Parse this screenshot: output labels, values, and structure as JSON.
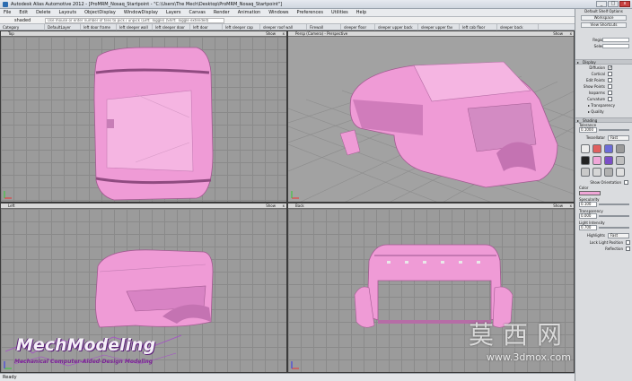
{
  "window": {
    "title": "Autodesk Alias Automotive 2012 - [ProMRM_Nosaq_Startpoint - \"C:\\Users\\The Mech\\Desktop\\ProMRM_Nosaq_Startpoint\"]",
    "minimize": "_",
    "maximize": "□",
    "close": "x"
  },
  "menu": [
    "File",
    "Edit",
    "Delete",
    "Layouts",
    "ObjectDisplay",
    "WindowDisplay",
    "Layers",
    "Canvas",
    "Render",
    "Animation",
    "Windows",
    "Preferences",
    "Utilities",
    "Help"
  ],
  "command": {
    "name": "shaded",
    "placeholder": "Use mouse or enter number of tiles to pick / unpick (Left: Toggle) (Shift: Toggle extended)"
  },
  "shelf": [
    "Category",
    "DefaultLayer",
    "left door frame",
    "left sleeper wall",
    "left sleeper door",
    "left door",
    "left sleeper cap",
    "sleeper roof wall",
    "Firewall",
    "sleeper floor",
    "sleeper upper back",
    "sleeper upper fav",
    "left cab floor",
    "sleeper back"
  ],
  "viewports": [
    {
      "label": "Top",
      "controls": "Show",
      "close": "x"
    },
    {
      "label": "Persp (Camera) - Perspective",
      "controls": "Show",
      "close": "x"
    },
    {
      "label": "Left",
      "controls": "Show",
      "close": "x"
    },
    {
      "label": "Back",
      "controls": "Show",
      "close": "x"
    }
  ],
  "status": "Ready",
  "panel": {
    "title": "Default Shelf Options",
    "buttons": [
      "Workspace",
      "View Shortcuts"
    ],
    "rows_top": [
      "Region",
      "Select"
    ],
    "display_section": "Display",
    "display_rows": [
      {
        "label": "Diffusion",
        "checked": "✓"
      },
      {
        "label": "Cortical",
        "checked": ""
      },
      {
        "label": "Edit Points",
        "checked": ""
      },
      {
        "label": "Show Points",
        "checked": ""
      },
      {
        "label": "Isoparms",
        "checked": ""
      },
      {
        "label": "Curvature",
        "checked": ""
      }
    ],
    "sub_items": [
      "Transparency",
      "Quality"
    ],
    "shading_section": "Shading",
    "tolerance": {
      "label": "Tolerance",
      "value": "0.1000"
    },
    "tessellator": {
      "label": "Tessellator",
      "value": "Fast"
    },
    "show_orientation": "Show Orientation",
    "color": {
      "label": "Color",
      "value": "#f0a6d8"
    },
    "specularity": {
      "label": "Specularity",
      "value": "0.100"
    },
    "transparency": {
      "label": "Transparency",
      "value": "0.000"
    },
    "light_intensity": {
      "label": "Light Intensity",
      "value": "0.700"
    },
    "highlights": {
      "label": "Highlights",
      "value": "Fast"
    },
    "lock_light": "Lock Light Position",
    "reflection": "Reflection"
  },
  "watermark": {
    "title": "MechModeling",
    "subtitle": "Mechanical Computer-Aided-Design Modeling",
    "cn": "莫西网",
    "url": "www.3dmox.com"
  },
  "colors": {
    "model_pink": "#ef9bd6",
    "model_shadow": "#b66da6",
    "grid_bg": "#9b9b9b"
  }
}
